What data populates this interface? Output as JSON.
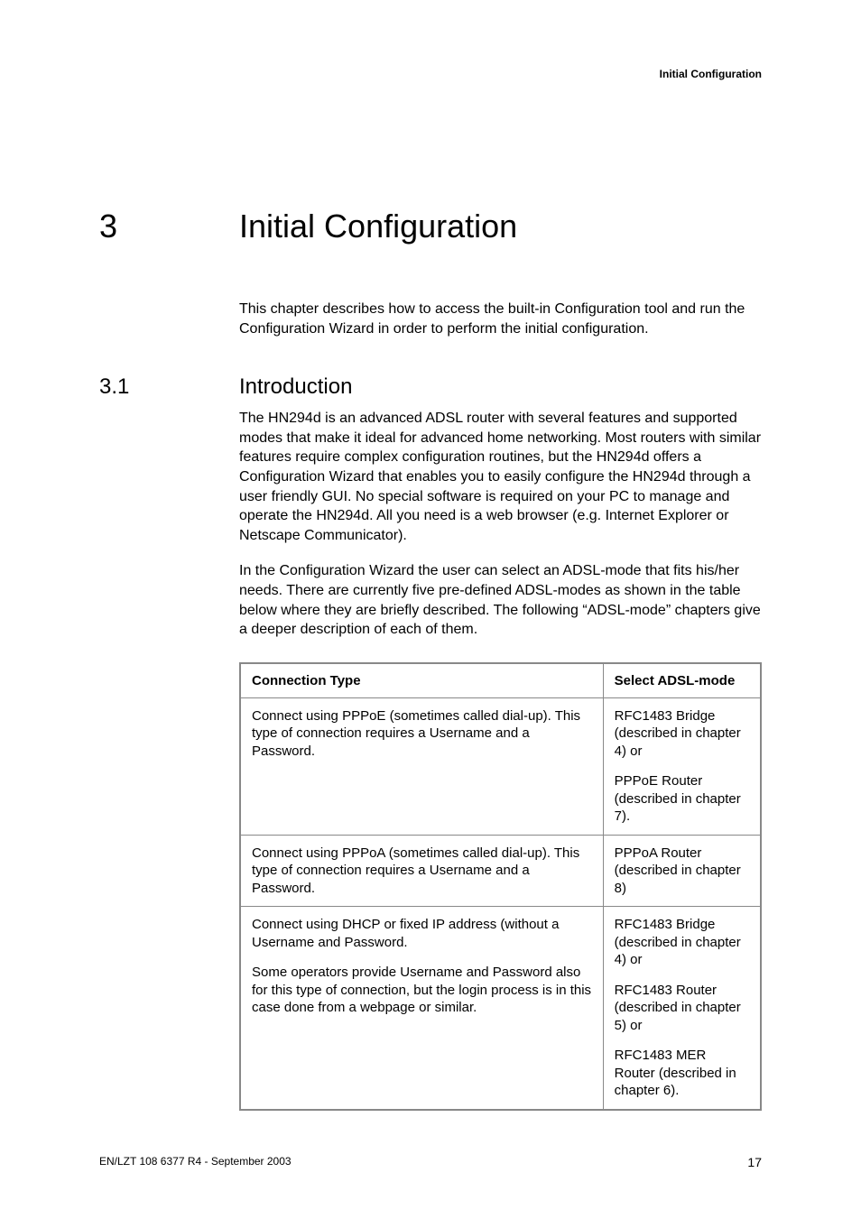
{
  "header": {
    "label": "Initial Configuration"
  },
  "chapter": {
    "number": "3",
    "title": "Initial Configuration"
  },
  "intro_para": "This chapter describes how to access the built-in Configuration tool and run the Configuration Wizard in order to perform the initial configuration.",
  "section": {
    "number": "3.1",
    "title": "Introduction"
  },
  "section_paras": [
    "The HN294d is an advanced ADSL router with several features and supported modes that make it ideal for advanced home networking. Most routers with similar features require complex configuration routines, but the HN294d offers a Configuration Wizard that enables you to easily configure the HN294d through a user friendly GUI. No special software is required on your PC to manage and operate the HN294d. All you need is a web browser (e.g. Internet Explorer or Netscape Communicator).",
    "In the Configuration Wizard the user can select an ADSL-mode that fits his/her needs. There are currently five pre-defined ADSL-modes as shown in the table below where they are briefly described. The following “ADSL-mode” chapters give a deeper description of each of them."
  ],
  "table": {
    "headers": [
      "Connection Type",
      "Select ADSL-mode"
    ],
    "rows": [
      {
        "left": [
          "Connect using PPPoE (sometimes called dial-up). This type of connection requires a Username and a Password."
        ],
        "right": [
          "RFC1483 Bridge (described in chapter 4) or",
          "PPPoE Router (described in chapter 7)."
        ]
      },
      {
        "left": [
          "Connect using PPPoA (sometimes called dial-up). This type of connection requires a Username and a Password."
        ],
        "right": [
          "PPPoA Router (described in chapter 8)"
        ]
      },
      {
        "left": [
          "Connect using DHCP or fixed IP address (without a Username and Password.",
          "Some operators provide Username and Password also for this type of connection, but the login process is in this case done from a webpage or similar."
        ],
        "right": [
          "RFC1483 Bridge (described in chapter 4) or",
          "RFC1483 Router (described in chapter 5) or",
          "RFC1483 MER Router (described in chapter 6)."
        ]
      }
    ]
  },
  "footer": {
    "left": "EN/LZT 108 6377 R4 - September 2003",
    "right": "17"
  }
}
